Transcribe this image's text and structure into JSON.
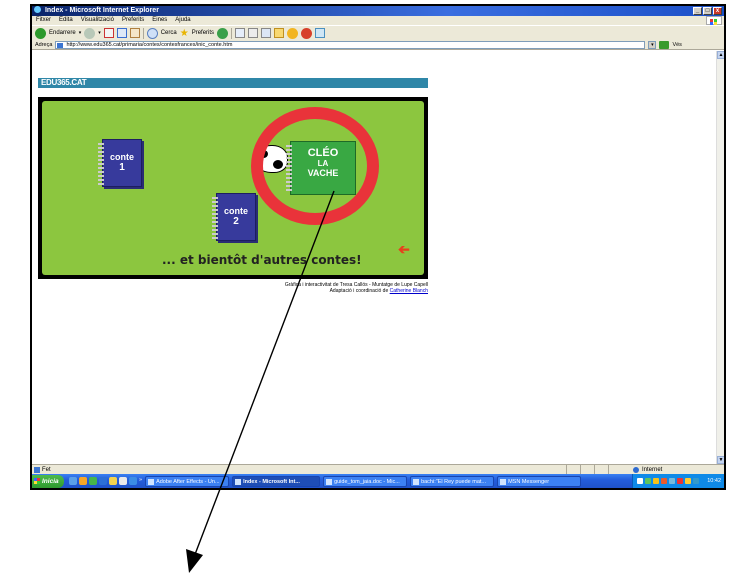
{
  "window": {
    "title": "Index - Microsoft Internet Explorer",
    "controls": [
      "_",
      "□",
      "x"
    ]
  },
  "menu": [
    "Fitxer",
    "Edita",
    "Visualització",
    "Preferits",
    "Eines",
    "Ajuda"
  ],
  "toolbar": {
    "back_label": "Endarrere",
    "search_label": "Cerca",
    "favorites_label": "Preferits"
  },
  "address": {
    "label": "Adreça",
    "url": "http://www.edu365.cat/primaria/contes/contesfrances/inic_conte.htm",
    "go_label": "Vés"
  },
  "page": {
    "banner": "EDU365.CAT",
    "book1": {
      "word": "conte",
      "number": "1"
    },
    "book2": {
      "word": "conte",
      "number": "2"
    },
    "featured_book": {
      "line1": "CLÉO",
      "line2": "LA",
      "line3": "VACHE"
    },
    "caption": "... et bientôt d'autres contes!",
    "back_arrow": "➔",
    "credits_line1": "Gràfica i interactivitat de Tresa Callós - Muntatge de Lupe Capell",
    "credits_line2_prefix": "Adaptació i coordinació de ",
    "credits_link": "Catherine Blanch"
  },
  "status": {
    "text": "Fet",
    "zone": "Internet"
  },
  "taskbar": {
    "start": "Inicia",
    "quicklaunch_more": "»",
    "tasks": [
      "Adobe After Effects - Un...",
      "Index - Microsoft Int...",
      "guide_tom_jaia.doc - Mic...",
      "bachi:\"El Rey puede mat...",
      "MSN Messenger"
    ],
    "clock": "10:42"
  },
  "colors": {
    "highlight_circle": "#e9333a",
    "game_background": "#8cc63f",
    "annotation_arrow": "#000000"
  }
}
